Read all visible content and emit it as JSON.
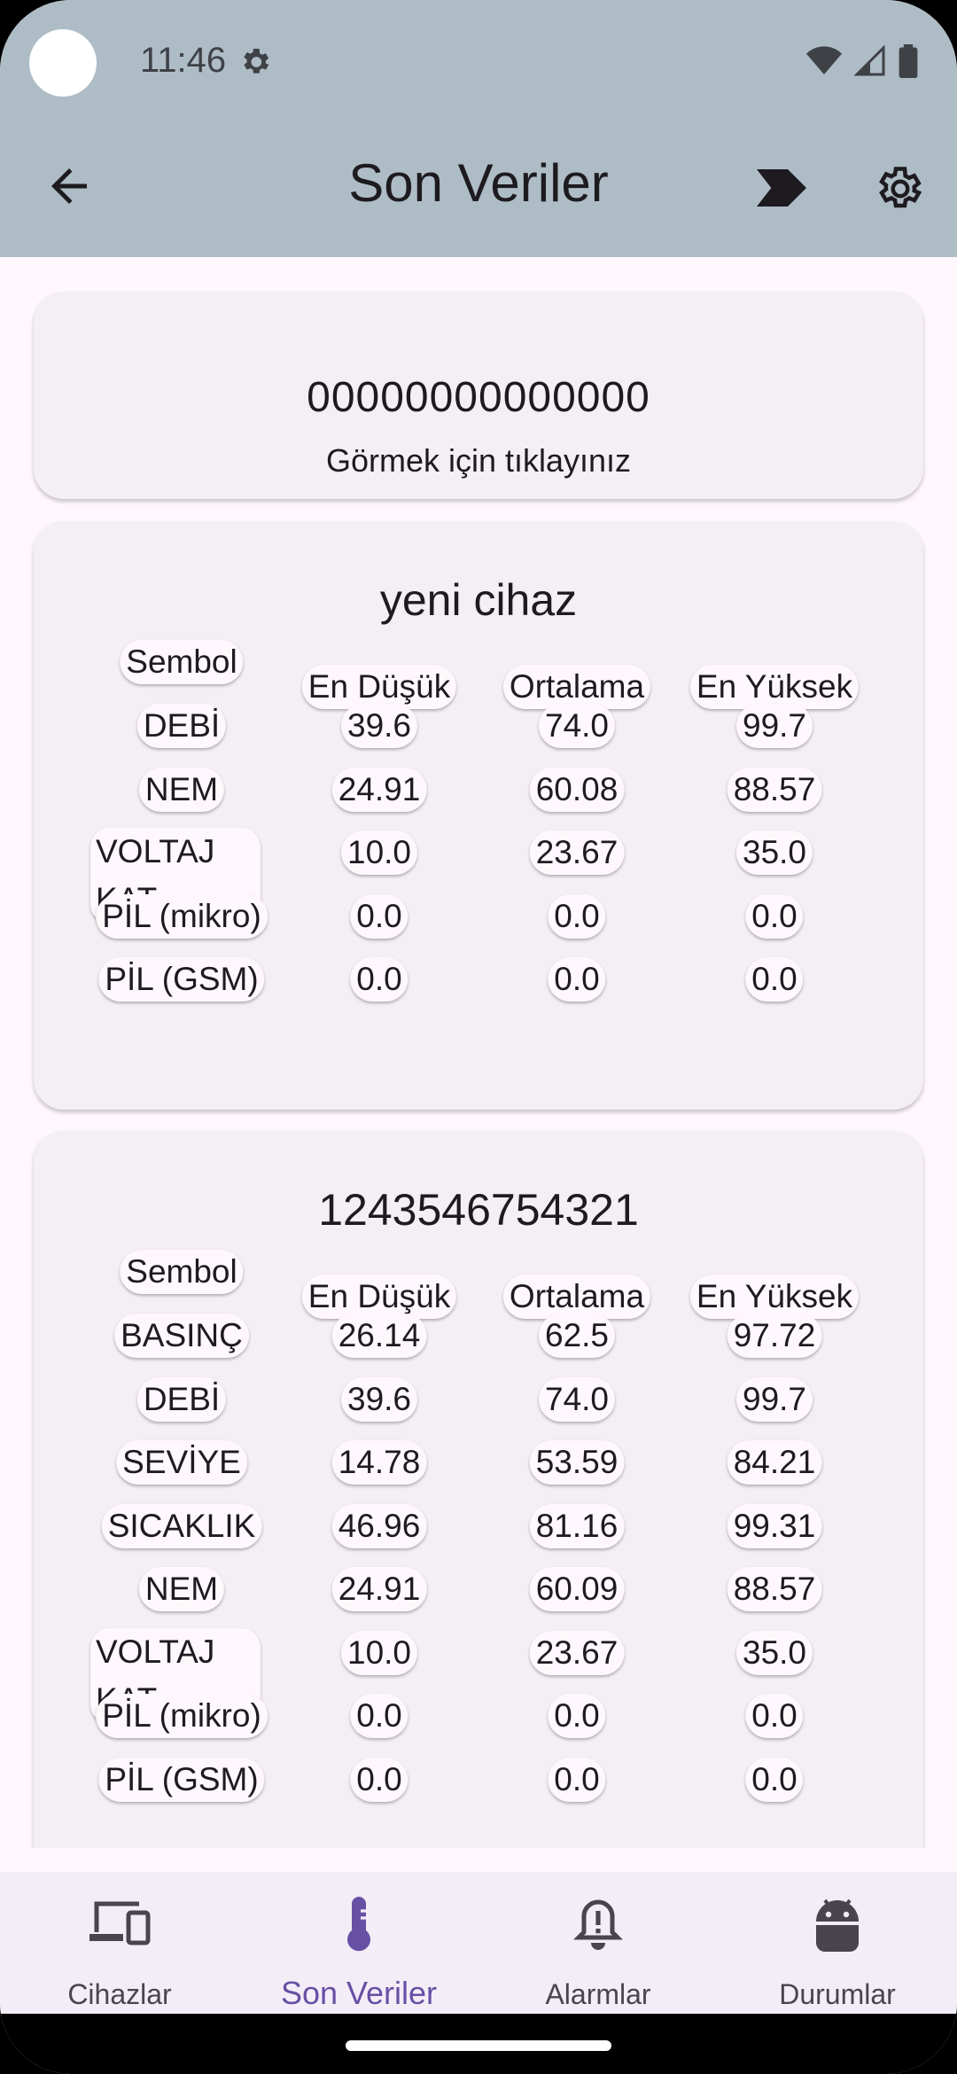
{
  "status_bar": {
    "time": "11:46"
  },
  "app_bar": {
    "title": "Son Veriler"
  },
  "device_card": {
    "id": "00000000000000",
    "hint": "Görmek için tıklayınız"
  },
  "devices": [
    {
      "name": "yeni cihaz",
      "header": {
        "symbol": "Sembol",
        "min": "En Düşük",
        "avg": "Ortalama",
        "max": "En Yüksek"
      },
      "rows": [
        {
          "symbol": "DEBİ",
          "min": "39.6",
          "avg": "74.0",
          "max": "99.7"
        },
        {
          "symbol": "NEM",
          "min": "24.91",
          "avg": "60.08",
          "max": "88.57"
        },
        {
          "symbol": "VOLTAJ KAT",
          "min": "10.0",
          "avg": "23.67",
          "max": "35.0"
        },
        {
          "symbol": "PİL (mikro)",
          "min": "0.0",
          "avg": "0.0",
          "max": "0.0"
        },
        {
          "symbol": "PİL (GSM)",
          "min": "0.0",
          "avg": "0.0",
          "max": "0.0"
        }
      ]
    },
    {
      "name": "1243546754321",
      "header": {
        "symbol": "Sembol",
        "min": "En Düşük",
        "avg": "Ortalama",
        "max": "En Yüksek"
      },
      "rows": [
        {
          "symbol": "BASINÇ",
          "min": "26.14",
          "avg": "62.5",
          "max": "97.72"
        },
        {
          "symbol": "DEBİ",
          "min": "39.6",
          "avg": "74.0",
          "max": "99.7"
        },
        {
          "symbol": "SEVİYE",
          "min": "14.78",
          "avg": "53.59",
          "max": "84.21"
        },
        {
          "symbol": "SICAKLIK",
          "min": "46.96",
          "avg": "81.16",
          "max": "99.31"
        },
        {
          "symbol": "NEM",
          "min": "24.91",
          "avg": "60.09",
          "max": "88.57"
        },
        {
          "symbol": "VOLTAJ KAT",
          "min": "10.0",
          "avg": "23.67",
          "max": "35.0"
        },
        {
          "symbol": "PİL (mikro)",
          "min": "0.0",
          "avg": "0.0",
          "max": "0.0"
        },
        {
          "symbol": "PİL (GSM)",
          "min": "0.0",
          "avg": "0.0",
          "max": "0.0"
        }
      ]
    }
  ],
  "nav": [
    {
      "label": "Cihazlar",
      "icon": "devices-icon",
      "active": false
    },
    {
      "label": "Son Veriler",
      "icon": "thermometer-icon",
      "active": true
    },
    {
      "label": "Alarmlar",
      "icon": "alarm-bell-icon",
      "active": false
    },
    {
      "label": "Durumlar",
      "icon": "android-icon",
      "active": false
    }
  ],
  "colors": {
    "app_bar": "#aebcc5",
    "accent": "#6750a4",
    "card": "#f4eff4",
    "background": "#fef7fc"
  }
}
